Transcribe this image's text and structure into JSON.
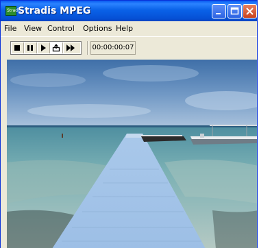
{
  "window": {
    "title": "Stradis MPEG",
    "app_icon_text": "Stradis"
  },
  "titlebar_buttons": {
    "minimize": "minimize-icon",
    "maximize": "maximize-icon",
    "close": "close-icon"
  },
  "menu": {
    "items": [
      "File",
      "View",
      "Control",
      "Options",
      "Help"
    ]
  },
  "toolbar": {
    "buttons": [
      "stop-icon",
      "pause-icon",
      "play-icon",
      "loop-icon",
      "fast-forward-icon"
    ],
    "timecode": "00:00:00:07"
  },
  "video": {
    "content": "playing-frame"
  },
  "colors": {
    "titlebar": "#0a62e8",
    "close_button": "#c9431e",
    "chrome": "#ece9d8"
  }
}
